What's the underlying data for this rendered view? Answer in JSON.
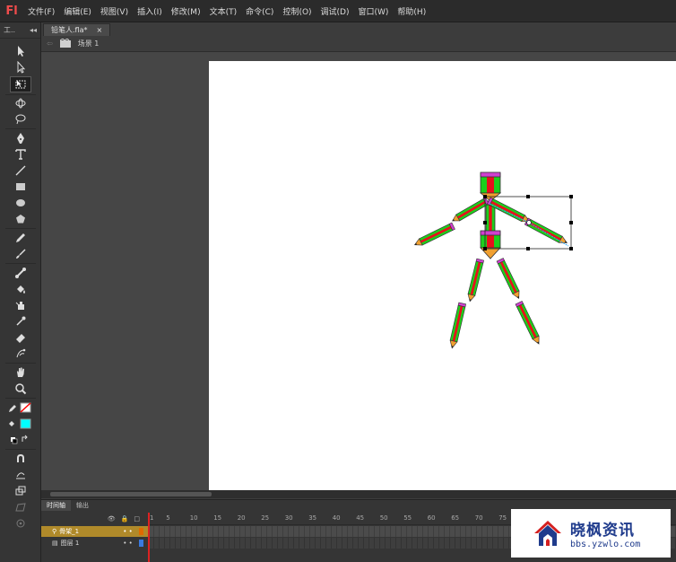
{
  "app": {
    "logo": "Fl"
  },
  "menubar": {
    "items": [
      "文件(F)",
      "编辑(E)",
      "视图(V)",
      "插入(I)",
      "修改(M)",
      "文本(T)",
      "命令(C)",
      "控制(O)",
      "调试(D)",
      "窗口(W)",
      "帮助(H)"
    ]
  },
  "toolbar": {
    "header_label": "工..",
    "header_arrows": "◂◂",
    "tools": [
      "selection-arrow",
      "subselection",
      "free-transform",
      "3d-rotation",
      "lasso",
      "pen",
      "text",
      "line",
      "rectangle",
      "oval",
      "polystar",
      "pencil",
      "brush",
      "bone",
      "paint-bucket",
      "ink-bottle",
      "eyedropper",
      "eraser",
      "deco",
      "hand",
      "zoom"
    ],
    "stroke_color": "#ff0000",
    "fill_color": "#00ffff"
  },
  "document": {
    "tab_title": "铅笔人.fla*",
    "close_glyph": "×"
  },
  "editbar": {
    "scene_label": "场景 1"
  },
  "timeline": {
    "tabs": [
      "时间轴",
      "输出"
    ],
    "frame_numbers": [
      "1",
      "5",
      "10",
      "15",
      "20",
      "25",
      "30",
      "35",
      "40",
      "45",
      "50",
      "55",
      "60",
      "65",
      "70",
      "75"
    ],
    "layers": [
      {
        "name": "骨架_1",
        "selected": true
      },
      {
        "name": "图层 1",
        "selected": false
      }
    ]
  },
  "watermark": {
    "title": "晓枫资讯",
    "subtitle": "bbs.yzwlo.com"
  },
  "colors": {
    "pencil_red": "#e8101c",
    "pencil_green": "#1ccf1c",
    "pencil_orange": "#f0a030",
    "pencil_eraser": "#d040d0"
  }
}
